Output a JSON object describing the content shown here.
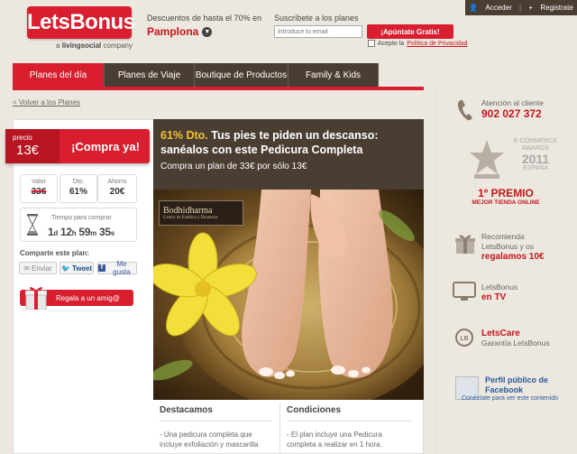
{
  "header": {
    "logo": "LetsBonus",
    "logo_sub_prefix": "a",
    "logo_sub_brand": "livingsocial",
    "logo_sub_suffix": "company",
    "discount_text": "Descuentos de hasta el 70% en",
    "city": "Pamplona",
    "subscribe_title": "Suscríbete a los planes",
    "email_placeholder": "Introduce tu email",
    "join_button": "¡Apúntate Gratis!",
    "accept_text": "Acepto la",
    "accept_link": "Política de Privacidad",
    "login": "Acceder",
    "register": "Registrate"
  },
  "nav": {
    "tabs": [
      {
        "label": "Planes del día",
        "active": true
      },
      {
        "label": "Planes de Viaje",
        "active": false
      },
      {
        "label": "Boutique de Productos",
        "active": false
      },
      {
        "label": "Family & Kids",
        "active": false
      }
    ]
  },
  "back_link": "< Volver a los Planes",
  "deal": {
    "price_label": "precio",
    "price": "13€",
    "buy_label": "¡Compra ya!",
    "stats": {
      "valor_label": "Valor",
      "valor": "33€",
      "dto_label": "Dto.",
      "dto": "61%",
      "ahorro_label": "Ahorro",
      "ahorro": "20€"
    },
    "timer_label": "Tiempo para comprar",
    "timer_days": "1",
    "timer_hours": "12",
    "timer_minutes": "59",
    "timer_seconds": "35",
    "timer_unit_d": "d",
    "timer_unit_h": "h",
    "timer_unit_m": "m",
    "timer_unit_s": "s",
    "share_title": "Comparte este plan:",
    "share_email": "Enviar",
    "share_tweet": "Tweet",
    "share_fb": "Me gusta",
    "gift_label": "Regala a un amig@",
    "title_pct": "61% Dto.",
    "title_rest": "Tus pies te piden un descanso: sanéalos con este Pedicura Completa",
    "subtitle": "Compra un plan de 33€ por sólo 13€",
    "brand": "Bodhidharma",
    "brand_sub": "Centro de Estética y Bienestar",
    "highlights_title": "Destacamos",
    "highlights_text": "- Una pedicura completa que incluye exfoliación y mascarilla",
    "conditions_title": "Condiciones",
    "conditions_text": "- El plan incluye una Pedicura completa a realizar en 1 hora."
  },
  "sidebar": {
    "attention": "Atención al cliente",
    "phone": "902 027 372",
    "award_line1": "E-COMMERCE",
    "award_line2": "AWARDS",
    "award_year": "2011",
    "award_country": "ESPAÑA",
    "premio": "1º PREMIO",
    "premio_sub": "MEJOR TIENDA ONLINE",
    "recommend_1": "Recomienda",
    "recommend_2": "LetsBonus y os",
    "recommend_3": "regalamos 10€",
    "tv_1": "LetsBonus",
    "tv_2": "en TV",
    "care_1": "LetsCare",
    "care_2": "Garantía LetsBonus",
    "fb_title": "Perfil público de Facebook",
    "fb_sub": "Conéctate para ver este contenido"
  },
  "colors": {
    "brand_red": "#d81e2f",
    "dark_brown": "#4a3e33",
    "accent_yellow": "#f0c230"
  }
}
